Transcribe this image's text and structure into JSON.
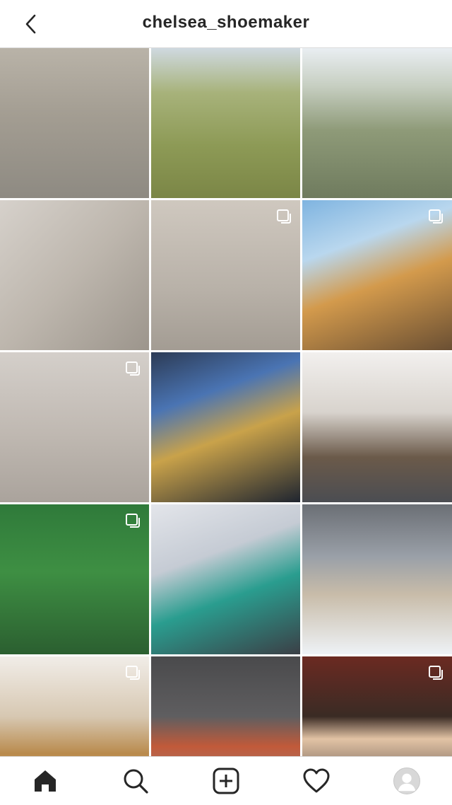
{
  "header": {
    "title": "chelsea_shoemaker",
    "back_icon": "chevron-left-icon"
  },
  "grid": {
    "posts": [
      {
        "id_label": "post-1",
        "multi": false
      },
      {
        "id_label": "post-2",
        "multi": false
      },
      {
        "id_label": "post-3",
        "multi": false
      },
      {
        "id_label": "post-4",
        "multi": false
      },
      {
        "id_label": "post-5",
        "multi": true
      },
      {
        "id_label": "post-6",
        "multi": true
      },
      {
        "id_label": "post-7",
        "multi": true
      },
      {
        "id_label": "post-8",
        "multi": false
      },
      {
        "id_label": "post-9",
        "multi": false
      },
      {
        "id_label": "post-10",
        "multi": true
      },
      {
        "id_label": "post-11",
        "multi": false
      },
      {
        "id_label": "post-12",
        "multi": false
      },
      {
        "id_label": "post-13",
        "multi": true
      },
      {
        "id_label": "post-14",
        "multi": false
      },
      {
        "id_label": "post-15",
        "multi": true
      }
    ]
  },
  "tabbar": {
    "items": [
      {
        "icon": "home-icon",
        "active": true
      },
      {
        "icon": "search-icon",
        "active": false
      },
      {
        "icon": "new-post-icon",
        "active": false
      },
      {
        "icon": "heart-icon",
        "active": false
      },
      {
        "icon": "profile-avatar",
        "active": false
      }
    ]
  },
  "colors": {
    "text": "#262626",
    "border": "#dbdbdb",
    "background": "#ffffff"
  }
}
